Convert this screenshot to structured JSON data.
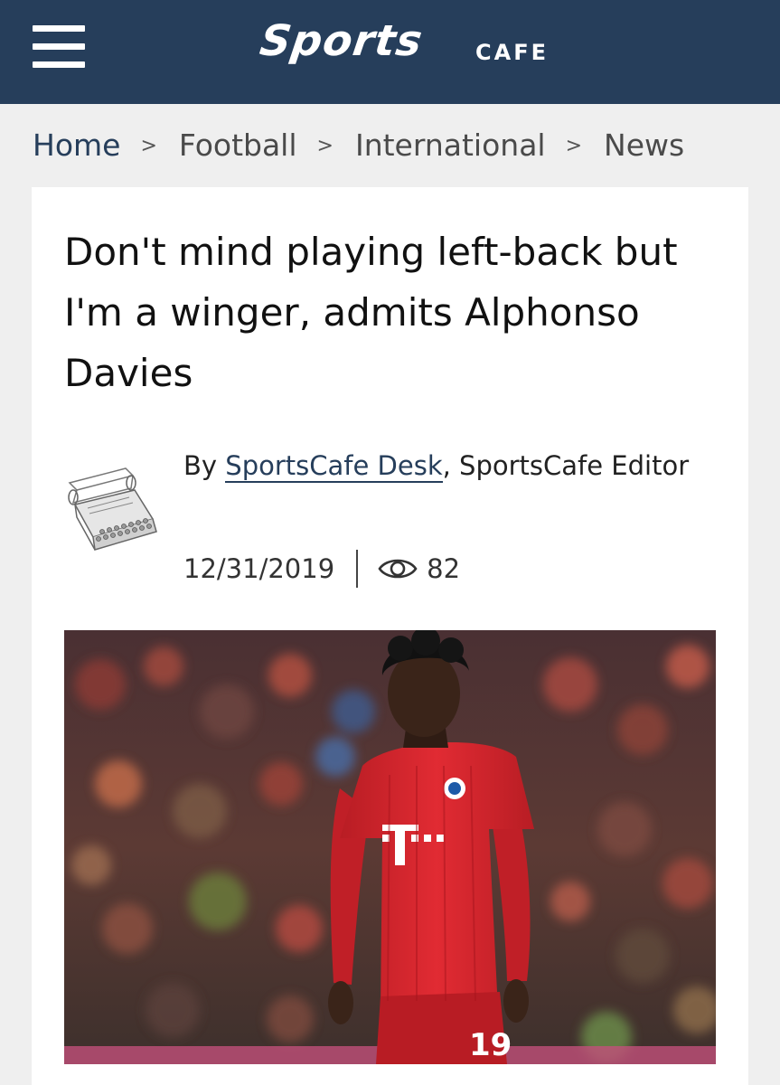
{
  "header": {
    "logo_main": "Sports",
    "logo_sub": "CAFE",
    "menu_icon": "hamburger-menu-icon"
  },
  "breadcrumb": [
    {
      "label": "Home"
    },
    {
      "label": "Football"
    },
    {
      "label": "International"
    },
    {
      "label": "News"
    }
  ],
  "breadcrumb_separator": ">",
  "article": {
    "title": "Don't mind playing left-back but I'm a winger, admits Alphonso Davies",
    "by_prefix": "By ",
    "author_name": "SportsCafe Desk",
    "author_suffix": ", SportsCafe Editor",
    "author_image_icon": "typewriter-icon",
    "date": "12/31/2019",
    "views_icon": "eye-icon",
    "views": "82",
    "hero_image": "player-in-red-kit-photo"
  },
  "colors": {
    "header_bg": "#263e5b",
    "page_bg": "#efefef",
    "card_bg": "#ffffff",
    "link": "#263e5b",
    "kit_red": "#d9232b"
  }
}
